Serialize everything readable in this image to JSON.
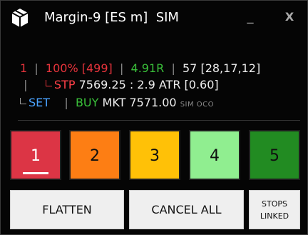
{
  "window": {
    "title": "Margin-9 [ES m]  SIM",
    "minimize_label": "_",
    "close_label": "X"
  },
  "info": {
    "line1": {
      "qty": "1",
      "pct": "100% [499]",
      "r_multiple": "4.91R",
      "stats": "57 [28,17,12]"
    },
    "line2": {
      "stp_label": "STP",
      "stp_value": "7569.25 : 2.9 ATR [0.60]"
    },
    "line3": {
      "set_label": "SET",
      "buy_label": "BUY",
      "order": "MKT 7571.00",
      "tags": "SIM OCO"
    },
    "separator": "|"
  },
  "number_buttons": [
    {
      "label": "1",
      "color": "#dc3545",
      "selected": true
    },
    {
      "label": "2",
      "color": "#fd7e14",
      "selected": false
    },
    {
      "label": "3",
      "color": "#ffc107",
      "selected": false
    },
    {
      "label": "4",
      "color": "#90ee90",
      "selected": false
    },
    {
      "label": "5",
      "color": "#228b22",
      "selected": false
    }
  ],
  "actions": {
    "flatten_label": "FLATTEN",
    "cancel_all_label": "CANCEL ALL",
    "stops_line1": "STOPS",
    "stops_line2": "LINKED"
  },
  "icons": {
    "app": "cube-icon"
  }
}
